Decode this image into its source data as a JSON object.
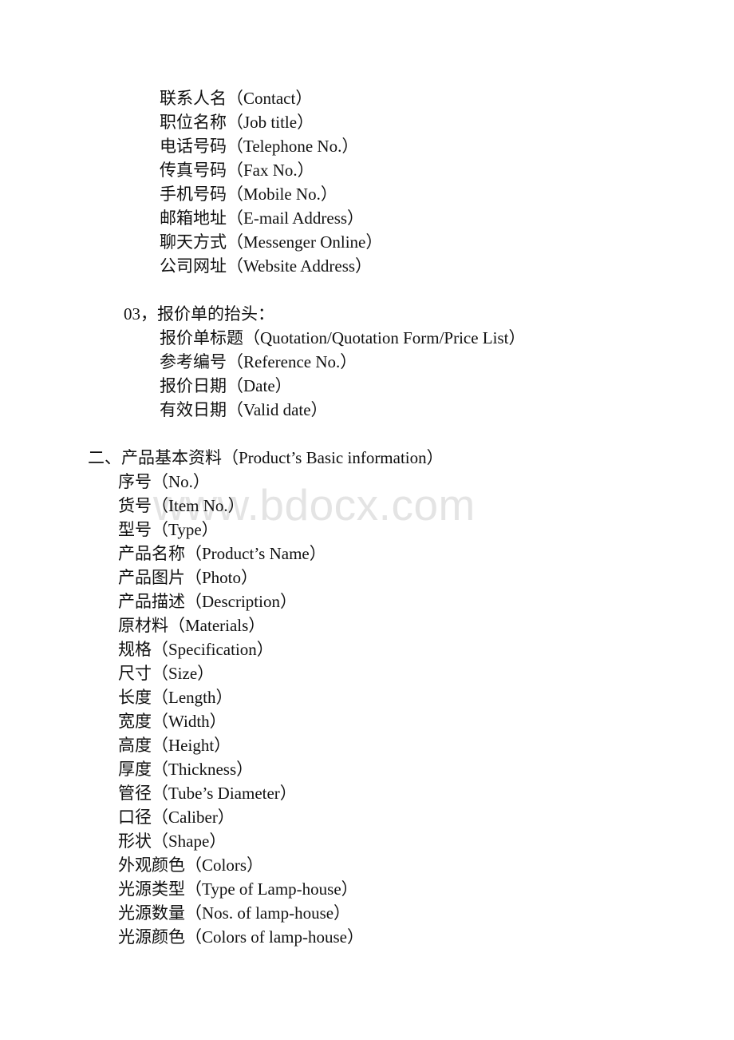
{
  "document": {
    "page_background": "#ffffff",
    "text_color": "#111111",
    "watermark": {
      "text": "www.bdocx.com",
      "color": "#e4e4e4"
    }
  },
  "blocks": [
    {
      "id": "contact-fields",
      "indent": "lvl-item-deep",
      "lines": [
        "联系人名（Contact）",
        "职位名称（Job title）",
        "电话号码（Telephone No.）",
        "传真号码（Fax No.）",
        "手机号码（Mobile No.）",
        "邮箱地址（E-mail Address）",
        "聊天方式（Messenger Online）",
        "公司网址（Website Address）"
      ]
    },
    {
      "id": "quotation-header-title",
      "indent": "lvl-number",
      "lines": [
        "03，报价单的抬头："
      ]
    },
    {
      "id": "quotation-header-fields",
      "indent": "lvl-item-deep",
      "lines": [
        "报价单标题（Quotation/Quotation Form/Price List）",
        "参考编号（Reference No.）",
        "报价日期（Date）",
        "有效日期（Valid date）"
      ]
    },
    {
      "id": "product-section-title",
      "indent": "lvl-section",
      "lines": [
        "二、产品基本资料（Product’s Basic information）"
      ]
    },
    {
      "id": "product-fields",
      "indent": "lvl-item",
      "lines": [
        "序号（No.）",
        "货号（Item No.）",
        "型号（Type）",
        "产品名称（Product’s Name）",
        "产品图片（Photo）",
        "产品描述（Description）",
        "原材料（Materials）",
        "规格（Specification）",
        "尺寸（Size）",
        "长度（Length）",
        "宽度（Width）",
        "高度（Height）",
        "厚度（Thickness）",
        "管径（Tube’s Diameter）",
        "口径（Caliber）",
        "形状（Shape）",
        "外观颜色（Colors）",
        "光源类型（Type of Lamp-house）",
        "光源数量（Nos. of lamp-house）",
        "光源颜色（Colors of lamp-house）"
      ]
    }
  ],
  "spacers_after_block": [
    true,
    false,
    true,
    false,
    false
  ]
}
